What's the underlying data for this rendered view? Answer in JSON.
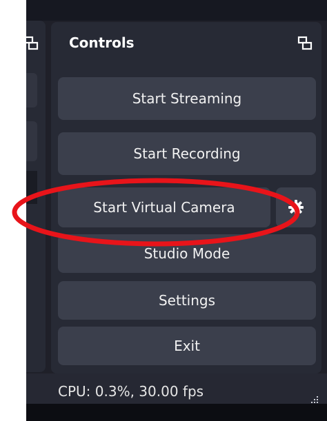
{
  "dock": {
    "title": "Controls"
  },
  "buttons": {
    "start_streaming": "Start Streaming",
    "start_recording": "Start Recording",
    "start_virtual_camera": "Start Virtual Camera",
    "studio_mode": "Studio Mode",
    "settings": "Settings",
    "exit": "Exit"
  },
  "status": {
    "text": "CPU: 0.3%, 30.00 fps"
  },
  "icons": {
    "dock_float_left": "window-float-icon",
    "dock_float_right": "window-float-icon",
    "virtual_camera_settings": "gear-icon",
    "resize_grip": "resize-grip-icon"
  },
  "colors": {
    "background": "#1f2029",
    "dock": "#272a35",
    "button": "#3b3f4c",
    "annotation": "#e8141a"
  }
}
